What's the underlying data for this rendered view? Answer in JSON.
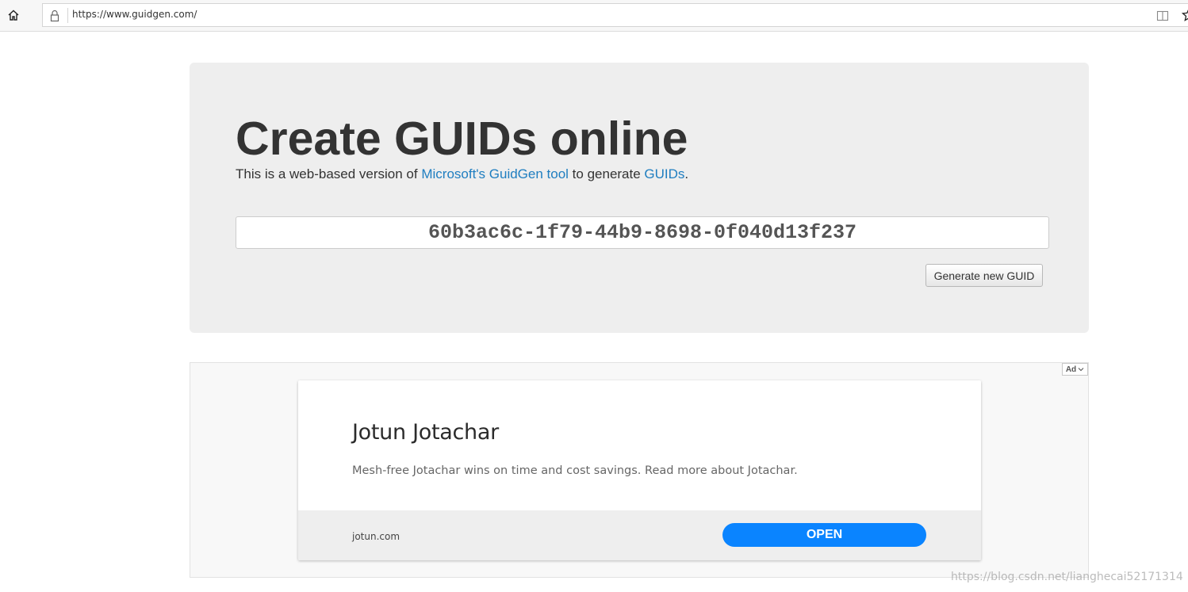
{
  "browser": {
    "url": "https://www.guidgen.com/",
    "icons": [
      "home-icon",
      "lock-icon",
      "reading-view-icon",
      "favorite-star-icon"
    ]
  },
  "jumbotron": {
    "title": "Create GUIDs online",
    "intro_prefix": "This is a web-based version of ",
    "intro_link1": "Microsoft's GuidGen tool",
    "intro_middle": " to generate ",
    "intro_link2": "GUIDs",
    "intro_suffix": ".",
    "guid_value": "60b3ac6c-1f79-44b9-8698-0f040d13f237",
    "generate_label": "Generate new GUID"
  },
  "ad": {
    "badge": "Ad",
    "headline": "Jotun Jotachar",
    "description": "Mesh-free Jotachar wins on time and cost savings. Read more about Jotachar.",
    "domain": "jotun.com",
    "cta": "OPEN"
  },
  "watermark": "https://blog.csdn.net/lianghecai52171314",
  "colors": {
    "link": "#1f7ec0",
    "jumbotron_bg": "#eeeeee",
    "cta_bg": "#0a84ff"
  }
}
